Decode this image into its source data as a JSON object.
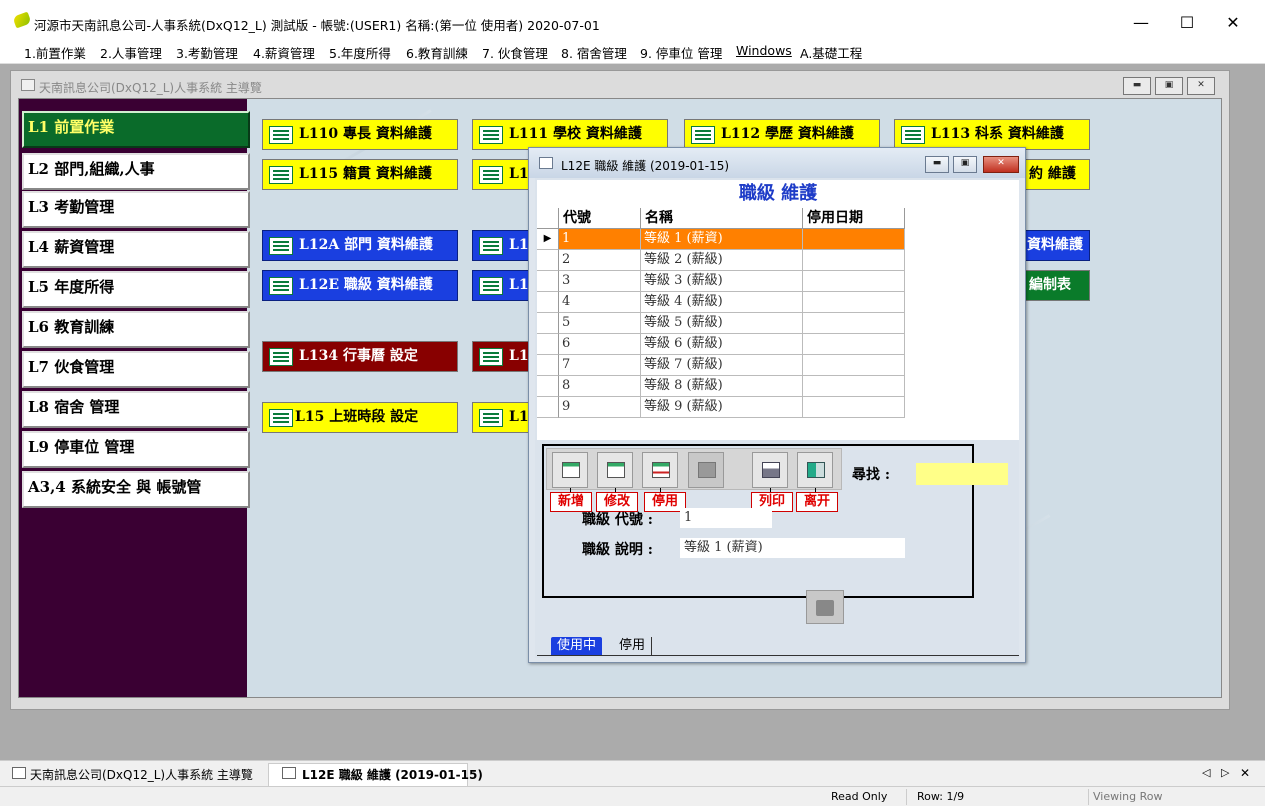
{
  "window": {
    "title": "河源市天南訊息公司-人事系統(DxQ12_L) 測試版 - 帳號:(USER1) 名稱:(第一位 使用者) 2020-07-01"
  },
  "menu": [
    "1.前置作業",
    "2.人事管理",
    "3.考勤管理",
    "4.薪資管理",
    "5.年度所得",
    "6.教育訓練",
    "7. 伙食管理",
    "8. 宿舍管理",
    "9. 停車位 管理",
    "Windows",
    "A.基礎工程"
  ],
  "main_window": {
    "title": "天南訊息公司(DxQ12_L)人事系統 主導覽"
  },
  "sidebar": [
    "L1  前置作業",
    "L2  部門,組織,人事",
    "L3  考勤管理",
    "L4  薪資管理",
    "L5  年度所得",
    "L6  教育訓練",
    "L7  伙食管理",
    "L8  宿舍  管理",
    "L9  停車位  管理",
    "A3,4  系統安全  與  帳號管"
  ],
  "modules": {
    "l110": "L110 專長 資料維護",
    "l111": "L111 學校 資料維護",
    "l112": "L112 學歷 資料維護",
    "l113": "L113 科系 資料維護",
    "l115": "L115 籍貫 資料維護",
    "l11_partial": "L1",
    "contract_partial": "約 維護",
    "l12a": "L12A 部門 資料維護",
    "l1_b1": "L1",
    "data_partial": "資料維護",
    "l12e": "L12E 職級 資料維護",
    "l1_b2": "L1",
    "schedule_partial": "編制表",
    "l134": "L134 行事曆 設定",
    "l1_r": "L1",
    "l15": "L15 上班時段 設定",
    "l1_y": "L1("
  },
  "dialog": {
    "window_title": "L12E 職級 維護 (2019-01-15)",
    "heading": "職級 維護",
    "columns": [
      "代號",
      "名稱",
      "停用日期"
    ],
    "selected_indicator": "▶",
    "rows": [
      {
        "code": "1",
        "name": "等級 1 (薪資)",
        "stop": ""
      },
      {
        "code": "2",
        "name": "等級 2 (薪級)",
        "stop": ""
      },
      {
        "code": "3",
        "name": "等級 3 (薪級)",
        "stop": ""
      },
      {
        "code": "4",
        "name": "等級 4 (薪級)",
        "stop": ""
      },
      {
        "code": "5",
        "name": "等級 5 (薪級)",
        "stop": ""
      },
      {
        "code": "6",
        "name": "等級 6 (薪級)",
        "stop": ""
      },
      {
        "code": "7",
        "name": "等級 7 (薪級)",
        "stop": ""
      },
      {
        "code": "8",
        "name": "等級 8 (薪級)",
        "stop": ""
      },
      {
        "code": "9",
        "name": "等級 9 (薪級)",
        "stop": ""
      }
    ],
    "labels": {
      "add": "新增",
      "edit": "修改",
      "disable": "停用",
      "print": "列印",
      "exit": "离开"
    },
    "search_label": "尋找 :",
    "search_value": "",
    "code_label": "職級 代號 :",
    "code_value": "1",
    "desc_label": "職級 說明 :",
    "desc_value": "等級 1 (薪資)",
    "tabs": [
      "使用中",
      "停用"
    ]
  },
  "taskbar": {
    "main": "天南訊息公司(DxQ12_L)人事系統 主導覽",
    "dialog": "L12E 職級 維護 (2019-01-15)"
  },
  "status": {
    "readonly": "Read Only",
    "row": "Row: 1/9",
    "mode": "Viewing Row"
  },
  "colors": {
    "sidebar_bg": "#3a0033",
    "active_green": "#0a6b2a",
    "button_yellow": "#ffff00",
    "button_blue": "#1a3fe0",
    "button_red": "#880000",
    "selected_row": "#ff8000"
  }
}
